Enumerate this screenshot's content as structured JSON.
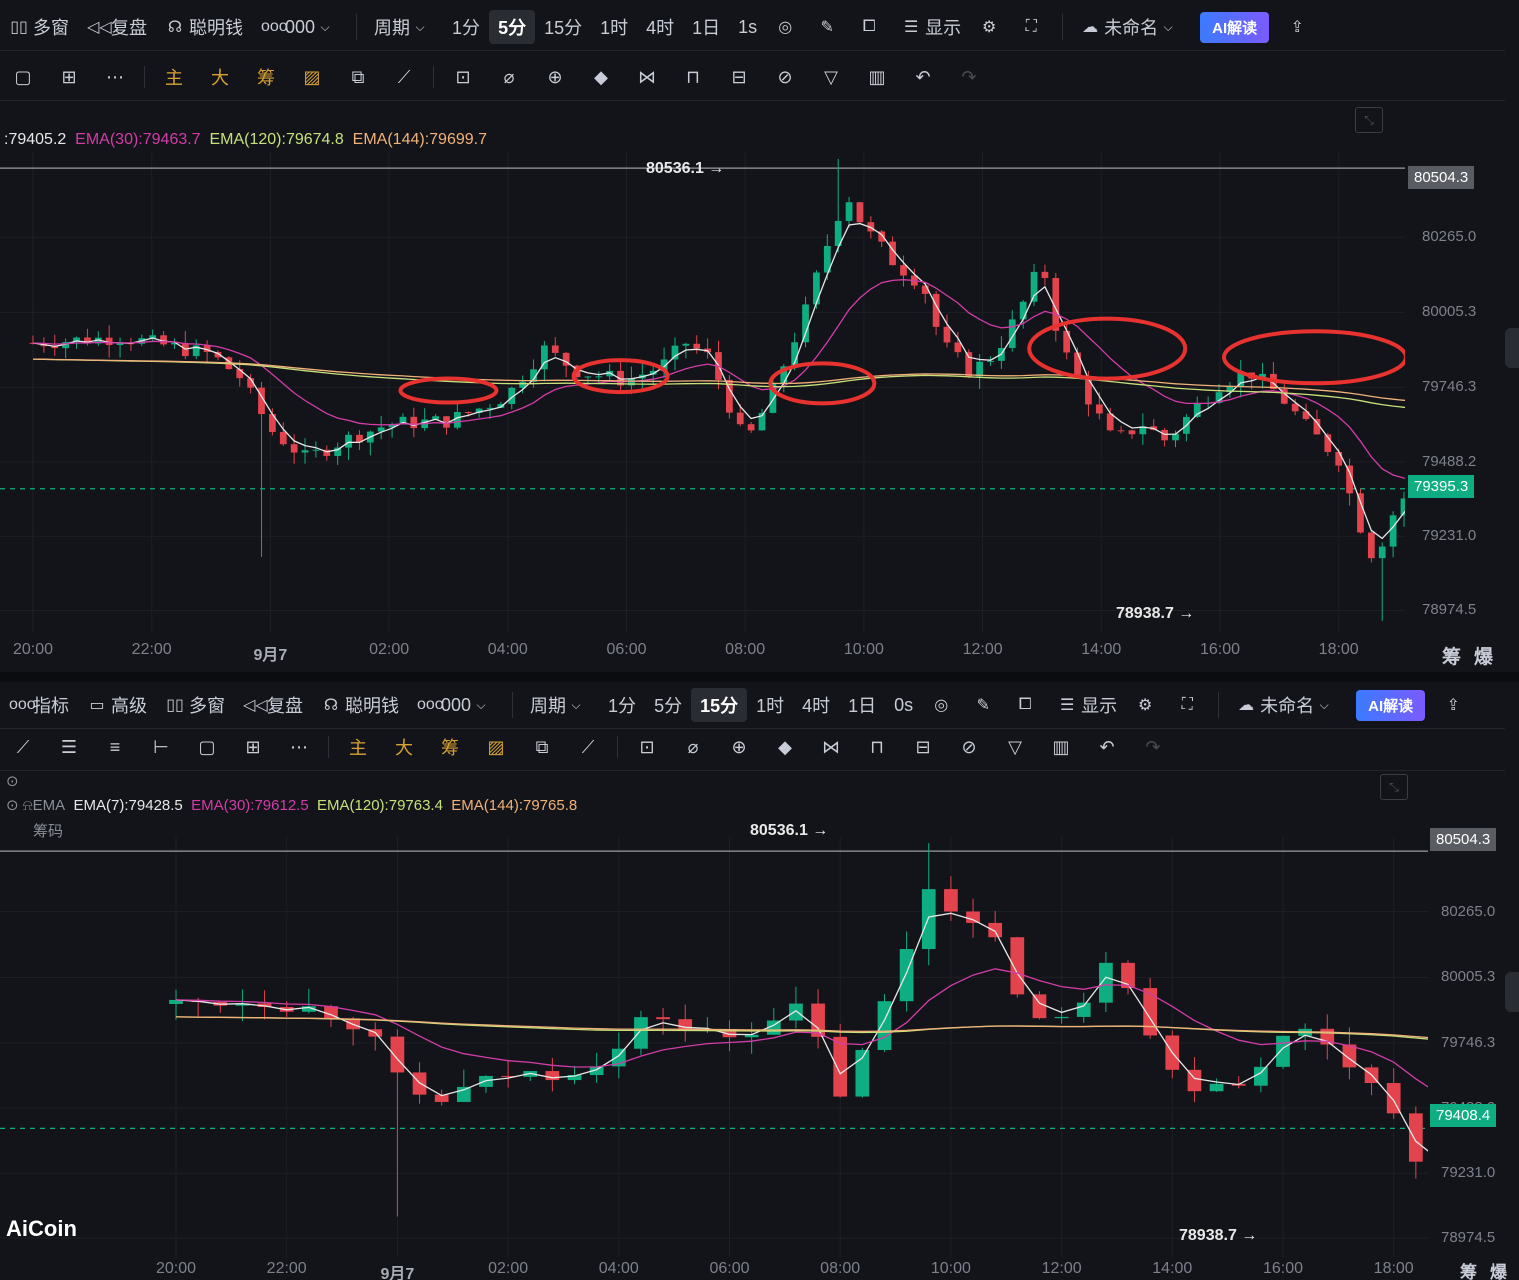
{
  "panel1": {
    "toolbar": [
      {
        "icon": "grid-icon",
        "label": "多窗"
      },
      {
        "icon": "replay-icon",
        "label": "复盘"
      },
      {
        "icon": "smart-money-icon",
        "label": "聪明钱"
      },
      {
        "icon": "indicator-icon",
        "label": "000"
      },
      {
        "icon": "",
        "label": "周期"
      },
      {
        "icon": "",
        "label": "1分"
      },
      {
        "icon": "",
        "label": "5分",
        "active": true
      },
      {
        "icon": "",
        "label": "15分"
      },
      {
        "icon": "",
        "label": "1时"
      },
      {
        "icon": "",
        "label": "4时"
      },
      {
        "icon": "",
        "label": "1日"
      },
      {
        "icon": "",
        "label": "1s"
      }
    ],
    "display_label": "显示",
    "layout_name": "未命名",
    "ai_label": "AI解读",
    "legend": {
      "ema7": ":79405.2",
      "ema30": "EMA(30):79463.7",
      "ema120": "EMA(120):79674.8",
      "ema144": "EMA(144):79699.7"
    },
    "high_label": "80536.1 →",
    "low_label": "78938.7 →",
    "top_tag": "80504.3",
    "current_tag": "79395.3",
    "corner_labels": [
      "筹",
      "爆"
    ]
  },
  "panel2": {
    "toolbar": [
      {
        "icon": "indicator-icon",
        "label": "指标"
      },
      {
        "icon": "advanced-icon",
        "label": "高级"
      },
      {
        "icon": "grid-icon",
        "label": "多窗"
      },
      {
        "icon": "replay-icon",
        "label": "复盘"
      },
      {
        "icon": "smart-money-icon",
        "label": "聪明钱"
      },
      {
        "icon": "indicator-icon",
        "label": "000"
      },
      {
        "icon": "",
        "label": "周期"
      },
      {
        "icon": "",
        "label": "1分"
      },
      {
        "icon": "",
        "label": "5分"
      },
      {
        "icon": "",
        "label": "15分",
        "active": true
      },
      {
        "icon": "",
        "label": "1时"
      },
      {
        "icon": "",
        "label": "4时"
      },
      {
        "icon": "",
        "label": "1日"
      },
      {
        "icon": "",
        "label": "0s"
      }
    ],
    "display_label": "显示",
    "layout_name": "未命名",
    "ai_label": "AI解读",
    "legend": {
      "name": "EMA",
      "ema7": "EMA(7):79428.5",
      "ema30": "EMA(30):79612.5",
      "ema120": "EMA(120):79763.4",
      "ema144": "EMA(144):79765.8"
    },
    "chip_label": "筹码",
    "high_label": "80536.1 →",
    "low_label": "78938.7 →",
    "top_tag": "80504.3",
    "current_tag": "79408.4",
    "corner_labels": [
      "筹",
      "爆"
    ],
    "logo": "AiCoin"
  },
  "chart_data": [
    {
      "type": "candlestick",
      "timeframe": "5分",
      "y_ticks": [
        80265.0,
        80005.3,
        79746.3,
        79488.2,
        79231.0,
        78974.5
      ],
      "x_ticks": [
        "20:00",
        "22:00",
        "9月7",
        "02:00",
        "04:00",
        "06:00",
        "08:00",
        "10:00",
        "12:00",
        "14:00",
        "16:00",
        "18:00"
      ],
      "ylim": [
        78900,
        80560
      ],
      "high": 80536.1,
      "low": 78938.7,
      "reference_line": 80504.3,
      "current_price": 79395.3,
      "series": [
        {
          "name": "EMA(7)",
          "last": 79405.2,
          "color": "#e7e7e7"
        },
        {
          "name": "EMA(30)",
          "last": 79463.7,
          "color": "#d23ca8"
        },
        {
          "name": "EMA(120)",
          "last": 79674.8,
          "color": "#c7e07a"
        },
        {
          "name": "EMA(144)",
          "last": 79699.7,
          "color": "#f1b27a"
        }
      ],
      "close_path": [
        [
          0,
          79900
        ],
        [
          1.5,
          79920
        ],
        [
          3,
          79860
        ],
        [
          3.5,
          79780
        ],
        [
          4,
          79600
        ],
        [
          4.6,
          79500
        ],
        [
          5.2,
          79560
        ],
        [
          6,
          79620
        ],
        [
          7,
          79630
        ],
        [
          7.6,
          79680
        ],
        [
          8,
          79720
        ],
        [
          8.6,
          79880
        ],
        [
          9.2,
          79800
        ],
        [
          10,
          79770
        ],
        [
          10.6,
          79820
        ],
        [
          11,
          79900
        ],
        [
          11.4,
          79850
        ],
        [
          12,
          79550
        ],
        [
          12.4,
          79700
        ],
        [
          13,
          80000
        ],
        [
          13.4,
          80250
        ],
        [
          13.7,
          80420
        ],
        [
          14,
          80300
        ],
        [
          14.5,
          80180
        ],
        [
          15,
          80100
        ],
        [
          15.3,
          79900
        ],
        [
          15.8,
          79800
        ],
        [
          16.2,
          79860
        ],
        [
          16.6,
          80000
        ],
        [
          17,
          80180
        ],
        [
          17.3,
          79900
        ],
        [
          17.8,
          79700
        ],
        [
          18.2,
          79560
        ],
        [
          18.7,
          79620
        ],
        [
          19.1,
          79560
        ],
        [
          19.6,
          79680
        ],
        [
          20,
          79760
        ],
        [
          20.5,
          79800
        ],
        [
          21,
          79720
        ],
        [
          21.5,
          79600
        ],
        [
          22,
          79500
        ],
        [
          22.3,
          79300
        ],
        [
          22.6,
          79150
        ],
        [
          23,
          79350
        ],
        [
          23.5,
          79420
        ],
        [
          24,
          79410
        ],
        [
          24.3,
          79400
        ]
      ],
      "annotation": "red ovals at ~02:00, ~04:00, ~06:00, ~10:00, ~14:00 on EMA crossings"
    },
    {
      "type": "candlestick",
      "timeframe": "15分",
      "y_ticks": [
        80265.0,
        80005.3,
        79746.3,
        79488.2,
        79231.0,
        78974.5
      ],
      "x_ticks": [
        "20:00",
        "22:00",
        "9月7",
        "02:00",
        "04:00",
        "06:00",
        "08:00",
        "10:00",
        "12:00",
        "14:00",
        "16:00",
        "18:00"
      ],
      "ylim": [
        78900,
        80560
      ],
      "high": 80536.1,
      "low": 78938.7,
      "reference_line": 80504.3,
      "current_price": 79408.4,
      "series": [
        {
          "name": "EMA(7)",
          "last": 79428.5,
          "color": "#e7e7e7"
        },
        {
          "name": "EMA(30)",
          "last": 79612.5,
          "color": "#d23ca8"
        },
        {
          "name": "EMA(120)",
          "last": 79763.4,
          "color": "#c7e07a"
        },
        {
          "name": "EMA(144)",
          "last": 79765.8,
          "color": "#f1b27a"
        }
      ]
    }
  ]
}
